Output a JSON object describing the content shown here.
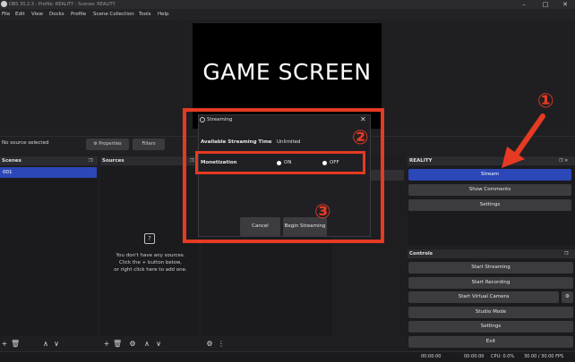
{
  "window": {
    "title": "OBS 30.2.3 - Profile: REALITY - Scenes: REALITY",
    "minimize": "–",
    "maximize": "□",
    "close": "✕"
  },
  "menu": [
    "File",
    "Edit",
    "View",
    "Docks",
    "Profile",
    "Scene Collection",
    "Tools",
    "Help"
  ],
  "preview": {
    "text": "GAME SCREEN"
  },
  "context": {
    "no_source": "No source selected",
    "properties": "Properties",
    "filters": "Filters"
  },
  "scenes": {
    "title": "Scenes",
    "items": [
      "001"
    ]
  },
  "sources": {
    "title": "Sources",
    "empty_line1": "You don't have any sources.",
    "empty_line2": "Click the + button below,",
    "empty_line3": "or right click here to add one."
  },
  "reality": {
    "title": "REALITY",
    "stream": "Stream",
    "show_comments": "Show Comments",
    "settings": "Settings"
  },
  "controls": {
    "title": "Controls",
    "start_streaming": "Start Streaming",
    "start_recording": "Start Recording",
    "start_virtual_camera": "Start Virtual Camera",
    "studio_mode": "Studio Mode",
    "settings": "Settings",
    "exit": "Exit"
  },
  "dialog": {
    "title": "Streaming",
    "close": "✕",
    "available_label": "Available Streaming Time",
    "available_value": "Unlimited",
    "monetization_label": "Monetization",
    "on_label": "ON",
    "off_label": "OFF",
    "cancel": "Cancel",
    "begin": "Begin Streaming"
  },
  "annotations": {
    "one": "①",
    "two": "②",
    "three": "③"
  },
  "status": {
    "time1": "00:00:00",
    "time2": "00:00:00",
    "cpu": "CPU: 0.0%",
    "fps": "30.00 / 30.00 FPS"
  },
  "icons": {
    "gear": "⚙",
    "plus": "+",
    "trash": "🗑",
    "up": "∧",
    "down": "∨",
    "dots": "⋮"
  },
  "colors": {
    "accent_blue": "#2c48b8",
    "annotation_red": "#e63a22"
  }
}
